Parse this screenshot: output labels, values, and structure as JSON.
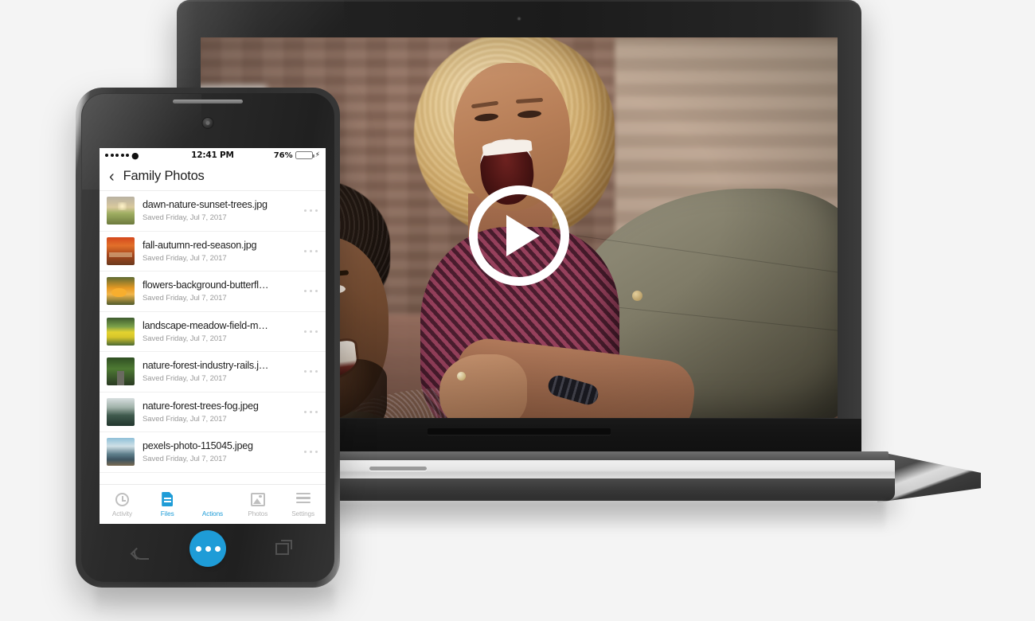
{
  "app": {
    "background_color": "#f4f4f4",
    "accent_color": "#1e9cd7"
  },
  "laptop": {
    "device_name": "laptop",
    "media": {
      "type": "video",
      "play_button_label": "Play",
      "description": "Two smiling people outdoors in front of a brick building, one giving the other a piggyback ride"
    }
  },
  "phone": {
    "device_name": "smartphone",
    "statusbar": {
      "signal_dots": 5,
      "wifi_icon": "wifi-icon",
      "time": "12:41 PM",
      "battery_percent": "76%",
      "battery_level": 76,
      "battery_color": "#4cd764",
      "charging_icon": "bolt-icon"
    },
    "navbar": {
      "back_icon": "chevron-left-icon",
      "title": "Family Photos"
    },
    "files": [
      {
        "name": "dawn-nature-sunset-trees.jpg",
        "meta": "Saved Friday, Jul 7, 2017",
        "thumb_class": "t0"
      },
      {
        "name": "fall-autumn-red-season.jpg",
        "meta": "Saved Friday, Jul 7, 2017",
        "thumb_class": "t1"
      },
      {
        "name": "flowers-background-butterfl…",
        "meta": "Saved Friday, Jul 7, 2017",
        "thumb_class": "t2"
      },
      {
        "name": "landscape-meadow-field-m…",
        "meta": "Saved Friday, Jul 7, 2017",
        "thumb_class": "t3"
      },
      {
        "name": "nature-forest-industry-rails.j…",
        "meta": "Saved Friday, Jul 7, 2017",
        "thumb_class": "t4"
      },
      {
        "name": "nature-forest-trees-fog.jpeg",
        "meta": "Saved Friday, Jul 7, 2017",
        "thumb_class": "t5"
      },
      {
        "name": "pexels-photo-115045.jpeg",
        "meta": "Saved Friday, Jul 7, 2017",
        "thumb_class": "t6"
      }
    ],
    "row_menu_icon": "ellipsis-icon",
    "tabbar": {
      "tabs": [
        {
          "label": "Activity",
          "icon": "clock-icon",
          "active": false
        },
        {
          "label": "Files",
          "icon": "file-icon",
          "active": true
        },
        {
          "label": "Actions",
          "icon": "ellipsis-circle-icon",
          "active": true
        },
        {
          "label": "Photos",
          "icon": "photo-icon",
          "active": false
        },
        {
          "label": "Settings",
          "icon": "hamburger-icon",
          "active": false
        }
      ]
    },
    "android_nav": {
      "back_icon": "android-back-icon",
      "home_icon": "android-home-icon",
      "recents_icon": "android-recents-icon"
    }
  }
}
